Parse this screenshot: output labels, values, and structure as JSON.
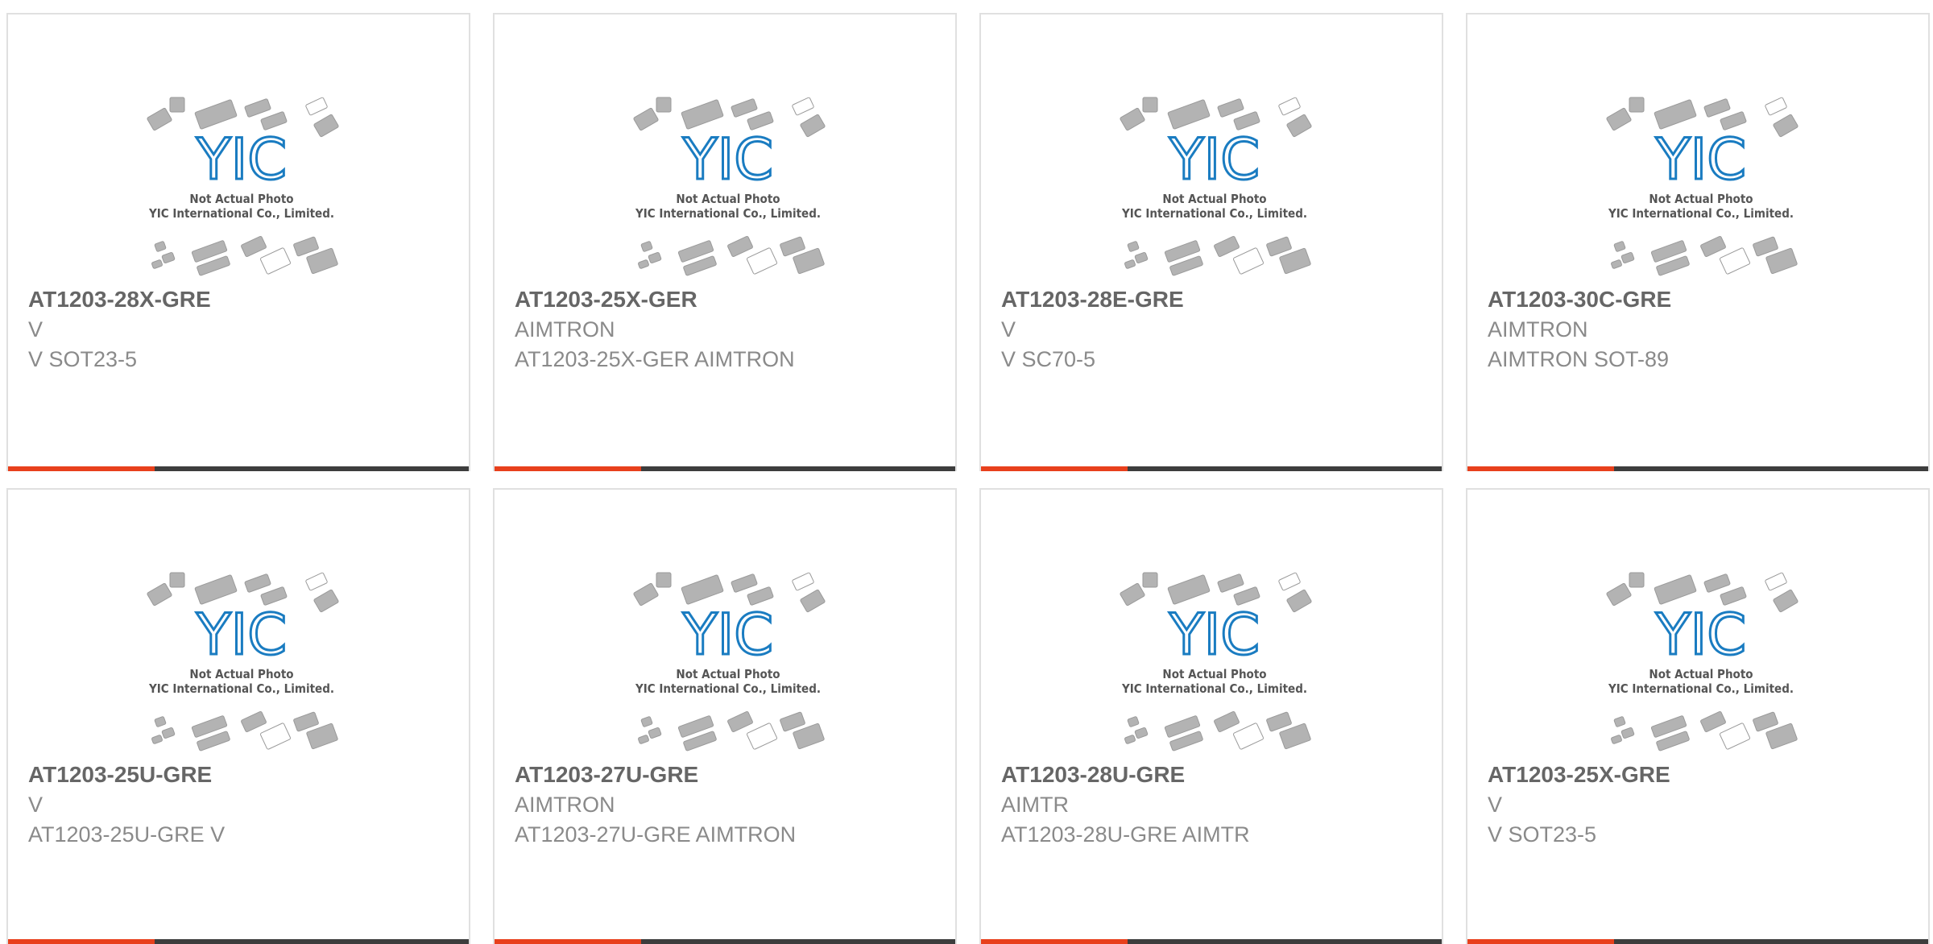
{
  "colors": {
    "accent_orange": "#e8401c",
    "accent_dark": "#3d3d3d",
    "logo_blue": "#1a7cc1",
    "chip_gray": "#b3b3b3"
  },
  "placeholder": {
    "logo_text": "YIC",
    "line1": "Not Actual Photo",
    "line2": "YIC International Co., Limited."
  },
  "products": [
    {
      "part_number": "AT1203-28X-GRE",
      "brand": "V",
      "description": "V SOT23-5"
    },
    {
      "part_number": "AT1203-25X-GER",
      "brand": "AIMTRON",
      "description": "AT1203-25X-GER AIMTRON"
    },
    {
      "part_number": "AT1203-28E-GRE",
      "brand": "V",
      "description": "V SC70-5"
    },
    {
      "part_number": "AT1203-30C-GRE",
      "brand": "AIMTRON",
      "description": "AIMTRON SOT-89"
    },
    {
      "part_number": "AT1203-25U-GRE",
      "brand": "V",
      "description": "AT1203-25U-GRE V"
    },
    {
      "part_number": "AT1203-27U-GRE",
      "brand": "AIMTRON",
      "description": "AT1203-27U-GRE AIMTRON"
    },
    {
      "part_number": "AT1203-28U-GRE",
      "brand": "AIMTR",
      "description": "AT1203-28U-GRE AIMTR"
    },
    {
      "part_number": "AT1203-25X-GRE",
      "brand": "V",
      "description": "V SOT23-5"
    }
  ]
}
